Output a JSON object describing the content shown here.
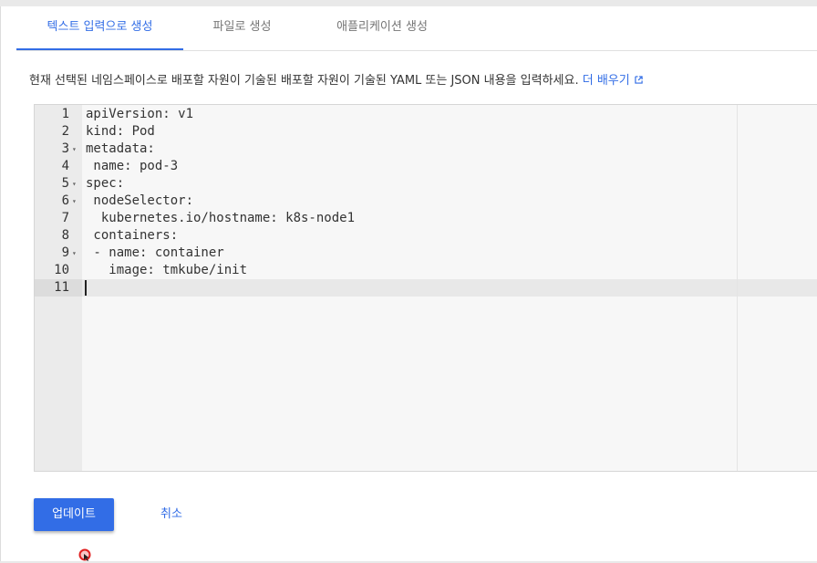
{
  "tabs": [
    {
      "label": "텍스트 입력으로 생성"
    },
    {
      "label": "파일로 생성"
    },
    {
      "label": "애플리케이션 생성"
    }
  ],
  "description": {
    "text": "현재 선택된 네임스페이스로 배포할 자원이 기술된 배포할 자원이 기술된 YAML 또는 JSON 내용을 입력하세요.",
    "learn_more": "더 배우기",
    "learn_more_icon": "open-in-new-icon"
  },
  "editor": {
    "lines": [
      {
        "num": "1",
        "code": "apiVersion: v1",
        "fold": ""
      },
      {
        "num": "2",
        "code": "kind: Pod",
        "fold": ""
      },
      {
        "num": "3",
        "code": "metadata:",
        "fold": "▾"
      },
      {
        "num": "4",
        "code": " name: pod-3",
        "fold": ""
      },
      {
        "num": "5",
        "code": "spec:",
        "fold": "▾"
      },
      {
        "num": "6",
        "code": " nodeSelector:",
        "fold": "▾"
      },
      {
        "num": "7",
        "code": "  kubernetes.io/hostname: k8s-node1",
        "fold": ""
      },
      {
        "num": "8",
        "code": " containers:",
        "fold": ""
      },
      {
        "num": "9",
        "code": " - name: container",
        "fold": "▾"
      },
      {
        "num": "10",
        "code": "   image: tmkube/init",
        "fold": ""
      },
      {
        "num": "11",
        "code": "",
        "fold": ""
      }
    ]
  },
  "actions": {
    "update": "업데이트",
    "cancel": "취소"
  },
  "colors": {
    "accent": "#326de6"
  }
}
